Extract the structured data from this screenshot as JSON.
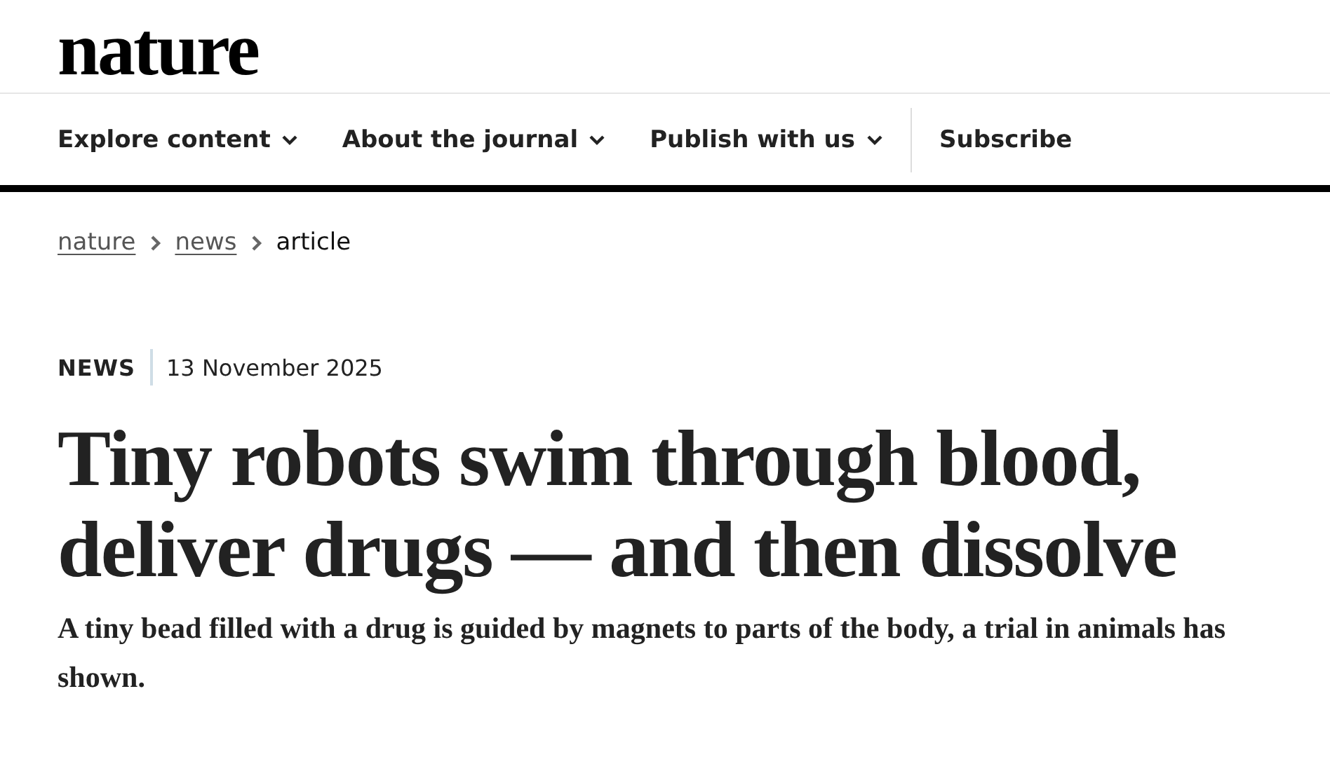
{
  "logo": "nature",
  "nav": [
    {
      "label": "Explore content",
      "kind": "dropdown"
    },
    {
      "label": "About the journal",
      "kind": "dropdown"
    },
    {
      "label": "Publish with us",
      "kind": "dropdown"
    },
    {
      "label": "Subscribe",
      "kind": "link"
    }
  ],
  "breadcrumb": [
    {
      "label": "nature",
      "kind": "link"
    },
    {
      "label": "news",
      "kind": "link"
    },
    {
      "label": "article",
      "kind": "current"
    }
  ],
  "article": {
    "type": "NEWS",
    "date": "13 November 2025",
    "title": "Tiny robots swim through blood, deliver drugs — and then dissolve",
    "standfirst": "A tiny bead filled with a drug is guided by magnets to parts of the body, a trial in animals has shown."
  }
}
